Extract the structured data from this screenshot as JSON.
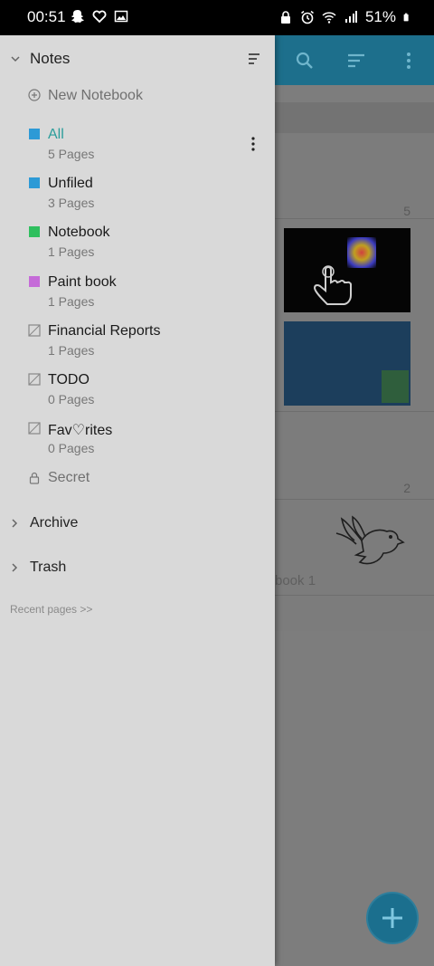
{
  "status_bar": {
    "time": "00:51",
    "battery": "51%",
    "left_icons": [
      "snapchat-icon",
      "heart-icon",
      "image-icon"
    ],
    "right_icons": [
      "lock-icon",
      "alarm-icon",
      "wifi-icon",
      "signal-icon",
      "battery-icon"
    ]
  },
  "drawer": {
    "header": "Notes",
    "new_notebook": "New Notebook",
    "notebooks": [
      {
        "title": "All",
        "pages": "5 Pages",
        "color": "#2d9ad6",
        "active": true
      },
      {
        "title": "Unfiled",
        "pages": "3 Pages",
        "color": "#2d9ad6"
      },
      {
        "title": "Notebook",
        "pages": "1 Pages",
        "color": "#2fbf5e"
      },
      {
        "title": "Paint book",
        "pages": "1 Pages",
        "color": "#c56bd8"
      },
      {
        "title": "Financial Reports",
        "pages": "1 Pages"
      },
      {
        "title": "TODO",
        "pages": "0 Pages"
      },
      {
        "title": "Fav♡rites",
        "pages": "0 Pages"
      }
    ],
    "secret": "Secret",
    "archive": "Archive",
    "trash": "Trash",
    "recent_pages": "Recent pages >>"
  },
  "background": {
    "count_1": "5",
    "count_2": "2",
    "notebook_snippet": "book 1"
  },
  "colors": {
    "accent_teal": "#2a9d9a",
    "toolbar": "#1d6f8c",
    "fab": "#1b6f8e"
  }
}
